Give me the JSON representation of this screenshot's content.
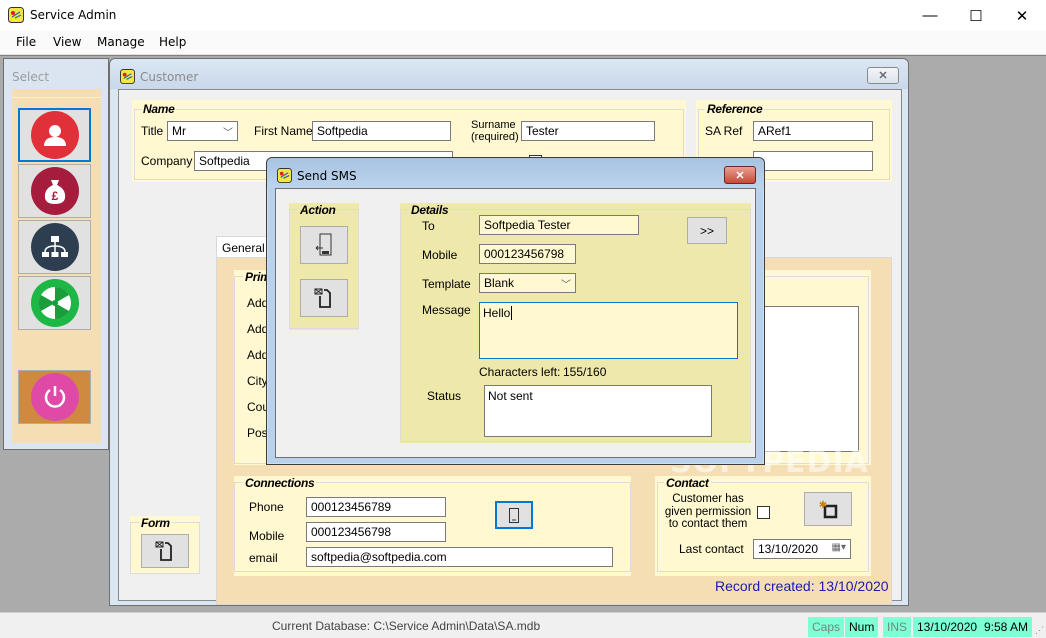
{
  "window": {
    "title": "Service Admin",
    "minimize_glyph": "—",
    "maximize_glyph": "☐",
    "close_glyph": "✕"
  },
  "menu": [
    "File",
    "View",
    "Manage",
    "Help"
  ],
  "select_panel": {
    "title": "Select",
    "buttons": [
      {
        "name": "customers",
        "icon": "user-icon",
        "color": "#e0303a"
      },
      {
        "name": "finance",
        "icon": "money-bag-pound-icon",
        "color": "#a51c3c"
      },
      {
        "name": "organisation",
        "icon": "hierarchy-icon",
        "color": "#2c3e50"
      },
      {
        "name": "service",
        "icon": "radiation-disc-icon",
        "color": "#1db746"
      },
      {
        "name": "exit",
        "icon": "power-icon",
        "color": "#e04aa7",
        "bg": "#d08a40"
      }
    ]
  },
  "customer": {
    "title": "Customer",
    "close_glyph": "✕",
    "name_group": {
      "legend": "Name",
      "title_label": "Title",
      "title_value": "Mr",
      "first_name_label": "First Name",
      "first_name_value": "Softpedia",
      "surname_label_line1": "Surname",
      "surname_label_line2": "(required)",
      "surname_value": "Tester",
      "company_label": "Company",
      "company_value": "Softpedia"
    },
    "reference_group": {
      "legend": "Reference",
      "sa_ref_label": "SA Ref",
      "sa_ref_value": "ARef1",
      "second_value": ""
    },
    "tabs": [
      {
        "label": "General"
      }
    ],
    "primary_group": {
      "legend": "Prima",
      "labels": [
        "Addre",
        "Addre",
        "Addre",
        "City",
        "Count",
        "Postc"
      ]
    },
    "connections_group": {
      "legend": "Connections",
      "phone_label": "Phone",
      "phone_value": "000123456789",
      "mobile_label": "Mobile",
      "mobile_value": "000123456798",
      "email_label": "email",
      "email_value": "softpedia@softpedia.com"
    },
    "contact_group": {
      "legend": "Contact",
      "permission_label": "Customer has given permission to contact them",
      "permission_checked": false,
      "last_contact_label": "Last contact",
      "last_contact_value": "13/10/2020"
    },
    "form_group": {
      "legend": "Form"
    },
    "record_created": "Record created:  13/10/2020"
  },
  "sms_dialog": {
    "title": "Send SMS",
    "close_glyph": "✕",
    "action_legend": "Action",
    "details_legend": "Details",
    "to_label": "To",
    "to_value": "Softpedia Tester",
    "mobile_label": "Mobile",
    "mobile_value": "000123456798",
    "template_label": "Template",
    "template_value": "Blank",
    "message_label": "Message",
    "message_value": "Hello",
    "chars_left_label": "Characters left:",
    "chars_left_value": "155/160",
    "status_label": "Status",
    "status_value": "Not sent",
    "forward_button": ">>"
  },
  "statusbar": {
    "database": "Current Database: C:\\Service Admin\\Data\\SA.mdb",
    "caps": "Caps",
    "num": "Num",
    "ins": "INS",
    "date": "13/10/2020",
    "time": "9:58 AM"
  },
  "watermark": "SOFTPEDIA"
}
